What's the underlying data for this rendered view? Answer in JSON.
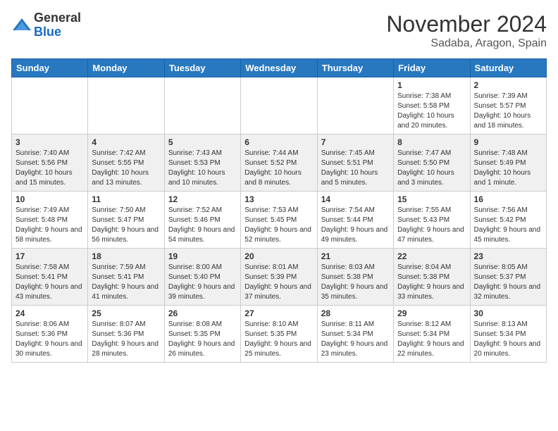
{
  "header": {
    "logo_general": "General",
    "logo_blue": "Blue",
    "month": "November 2024",
    "location": "Sadaba, Aragon, Spain"
  },
  "weekdays": [
    "Sunday",
    "Monday",
    "Tuesday",
    "Wednesday",
    "Thursday",
    "Friday",
    "Saturday"
  ],
  "weeks": [
    [
      {
        "day": "",
        "info": ""
      },
      {
        "day": "",
        "info": ""
      },
      {
        "day": "",
        "info": ""
      },
      {
        "day": "",
        "info": ""
      },
      {
        "day": "",
        "info": ""
      },
      {
        "day": "1",
        "info": "Sunrise: 7:38 AM\nSunset: 5:58 PM\nDaylight: 10 hours and 20 minutes."
      },
      {
        "day": "2",
        "info": "Sunrise: 7:39 AM\nSunset: 5:57 PM\nDaylight: 10 hours and 18 minutes."
      }
    ],
    [
      {
        "day": "3",
        "info": "Sunrise: 7:40 AM\nSunset: 5:56 PM\nDaylight: 10 hours and 15 minutes."
      },
      {
        "day": "4",
        "info": "Sunrise: 7:42 AM\nSunset: 5:55 PM\nDaylight: 10 hours and 13 minutes."
      },
      {
        "day": "5",
        "info": "Sunrise: 7:43 AM\nSunset: 5:53 PM\nDaylight: 10 hours and 10 minutes."
      },
      {
        "day": "6",
        "info": "Sunrise: 7:44 AM\nSunset: 5:52 PM\nDaylight: 10 hours and 8 minutes."
      },
      {
        "day": "7",
        "info": "Sunrise: 7:45 AM\nSunset: 5:51 PM\nDaylight: 10 hours and 5 minutes."
      },
      {
        "day": "8",
        "info": "Sunrise: 7:47 AM\nSunset: 5:50 PM\nDaylight: 10 hours and 3 minutes."
      },
      {
        "day": "9",
        "info": "Sunrise: 7:48 AM\nSunset: 5:49 PM\nDaylight: 10 hours and 1 minute."
      }
    ],
    [
      {
        "day": "10",
        "info": "Sunrise: 7:49 AM\nSunset: 5:48 PM\nDaylight: 9 hours and 58 minutes."
      },
      {
        "day": "11",
        "info": "Sunrise: 7:50 AM\nSunset: 5:47 PM\nDaylight: 9 hours and 56 minutes."
      },
      {
        "day": "12",
        "info": "Sunrise: 7:52 AM\nSunset: 5:46 PM\nDaylight: 9 hours and 54 minutes."
      },
      {
        "day": "13",
        "info": "Sunrise: 7:53 AM\nSunset: 5:45 PM\nDaylight: 9 hours and 52 minutes."
      },
      {
        "day": "14",
        "info": "Sunrise: 7:54 AM\nSunset: 5:44 PM\nDaylight: 9 hours and 49 minutes."
      },
      {
        "day": "15",
        "info": "Sunrise: 7:55 AM\nSunset: 5:43 PM\nDaylight: 9 hours and 47 minutes."
      },
      {
        "day": "16",
        "info": "Sunrise: 7:56 AM\nSunset: 5:42 PM\nDaylight: 9 hours and 45 minutes."
      }
    ],
    [
      {
        "day": "17",
        "info": "Sunrise: 7:58 AM\nSunset: 5:41 PM\nDaylight: 9 hours and 43 minutes."
      },
      {
        "day": "18",
        "info": "Sunrise: 7:59 AM\nSunset: 5:41 PM\nDaylight: 9 hours and 41 minutes."
      },
      {
        "day": "19",
        "info": "Sunrise: 8:00 AM\nSunset: 5:40 PM\nDaylight: 9 hours and 39 minutes."
      },
      {
        "day": "20",
        "info": "Sunrise: 8:01 AM\nSunset: 5:39 PM\nDaylight: 9 hours and 37 minutes."
      },
      {
        "day": "21",
        "info": "Sunrise: 8:03 AM\nSunset: 5:38 PM\nDaylight: 9 hours and 35 minutes."
      },
      {
        "day": "22",
        "info": "Sunrise: 8:04 AM\nSunset: 5:38 PM\nDaylight: 9 hours and 33 minutes."
      },
      {
        "day": "23",
        "info": "Sunrise: 8:05 AM\nSunset: 5:37 PM\nDaylight: 9 hours and 32 minutes."
      }
    ],
    [
      {
        "day": "24",
        "info": "Sunrise: 8:06 AM\nSunset: 5:36 PM\nDaylight: 9 hours and 30 minutes."
      },
      {
        "day": "25",
        "info": "Sunrise: 8:07 AM\nSunset: 5:36 PM\nDaylight: 9 hours and 28 minutes."
      },
      {
        "day": "26",
        "info": "Sunrise: 8:08 AM\nSunset: 5:35 PM\nDaylight: 9 hours and 26 minutes."
      },
      {
        "day": "27",
        "info": "Sunrise: 8:10 AM\nSunset: 5:35 PM\nDaylight: 9 hours and 25 minutes."
      },
      {
        "day": "28",
        "info": "Sunrise: 8:11 AM\nSunset: 5:34 PM\nDaylight: 9 hours and 23 minutes."
      },
      {
        "day": "29",
        "info": "Sunrise: 8:12 AM\nSunset: 5:34 PM\nDaylight: 9 hours and 22 minutes."
      },
      {
        "day": "30",
        "info": "Sunrise: 8:13 AM\nSunset: 5:34 PM\nDaylight: 9 hours and 20 minutes."
      }
    ]
  ]
}
